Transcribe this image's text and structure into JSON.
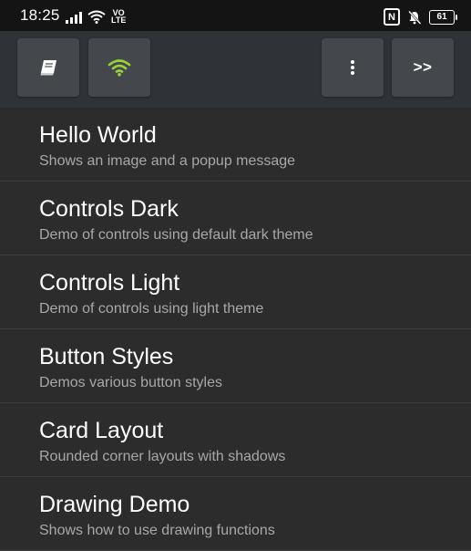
{
  "status_bar": {
    "time": "18:25",
    "network_label": "VO\nLTE",
    "nfc_label": "N",
    "battery_level": "61"
  },
  "toolbar": {
    "buttons": [
      {
        "icon": "book-icon"
      },
      {
        "icon": "wifi-icon"
      },
      {
        "icon": "more-vertical-icon"
      },
      {
        "label": ">>"
      }
    ],
    "wifi_color": "#9bd03a"
  },
  "list": {
    "items": [
      {
        "title": "Hello World",
        "subtitle": "Shows an image and a popup message"
      },
      {
        "title": "Controls Dark",
        "subtitle": "Demo of controls using default dark theme"
      },
      {
        "title": "Controls Light",
        "subtitle": "Demo of controls using light theme"
      },
      {
        "title": "Button Styles",
        "subtitle": "Demos various button styles"
      },
      {
        "title": "Card Layout",
        "subtitle": "Rounded corner layouts with shadows"
      },
      {
        "title": "Drawing Demo",
        "subtitle": "Shows how to use drawing functions"
      }
    ]
  }
}
